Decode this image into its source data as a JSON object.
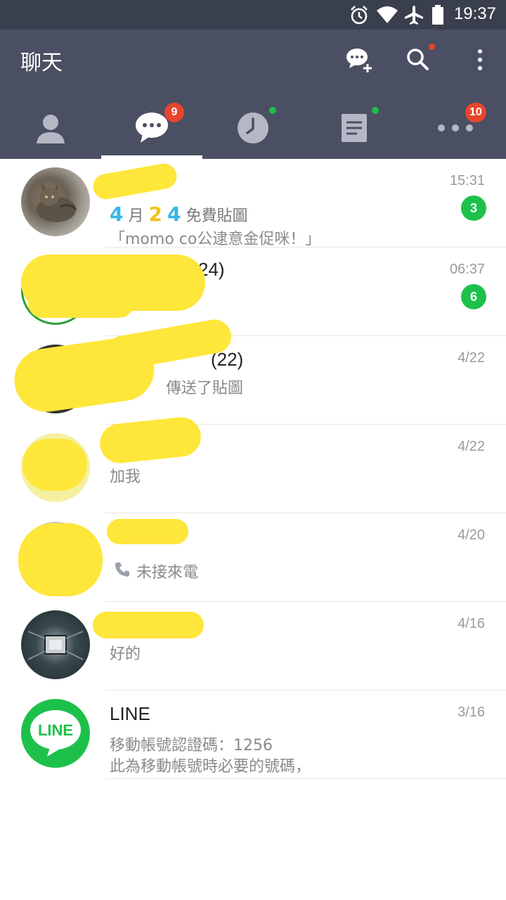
{
  "status_bar": {
    "time": "19:37",
    "icons": [
      "alarm-icon",
      "wifi-icon",
      "airplane-icon",
      "battery-icon"
    ]
  },
  "header": {
    "title": "聊天",
    "actions": [
      "add-chat-icon",
      "search-icon",
      "more-vert-icon"
    ],
    "colors": {
      "background": "#4a4f63",
      "status_bar": "#3a3f4e",
      "badge": "#e8452c",
      "dot": "#1dc14a"
    }
  },
  "tabs": [
    {
      "name": "friends",
      "icon": "person-icon"
    },
    {
      "name": "chats",
      "icon": "chat-bubble-icon",
      "badge": "9",
      "active": true
    },
    {
      "name": "timeline",
      "icon": "clock-icon"
    },
    {
      "name": "news",
      "icon": "document-icon"
    },
    {
      "name": "more",
      "icon": "more-horiz-icon",
      "badge": "10"
    }
  ],
  "chats": [
    {
      "name": "",
      "message_line1": "4 月 2 4 免費貼圖",
      "message_line2": "「momo co公逮意金促咪！」",
      "time": "15:31",
      "unread": "3"
    },
    {
      "name": "24)",
      "message_line1": "",
      "message_line2": "",
      "time": "06:37",
      "unread": "6"
    },
    {
      "name": "(22)",
      "message_line1": "傳送了貼圖",
      "message_line2": "",
      "time": "4/22",
      "unread": ""
    },
    {
      "name": "",
      "message_line1": "加我",
      "message_line2": "",
      "time": "4/22",
      "unread": ""
    },
    {
      "name": "",
      "message_line1": "未接來電",
      "message_line2": "",
      "time": "4/20",
      "unread": ""
    },
    {
      "name": "",
      "message_line1": "好的",
      "message_line2": "",
      "time": "4/16",
      "unread": ""
    },
    {
      "name": "LINE",
      "message_line1": "移動帳號認證碼：1256",
      "message_line2": "此為移動帳號時必要的號碼，",
      "time": "3/16",
      "unread": "",
      "avatar_text": "LINE"
    }
  ],
  "first_message_parts": {
    "d1": "4",
    "m": "月",
    "d2": "2",
    "d3": "4",
    "rest": "免費貼圖"
  }
}
